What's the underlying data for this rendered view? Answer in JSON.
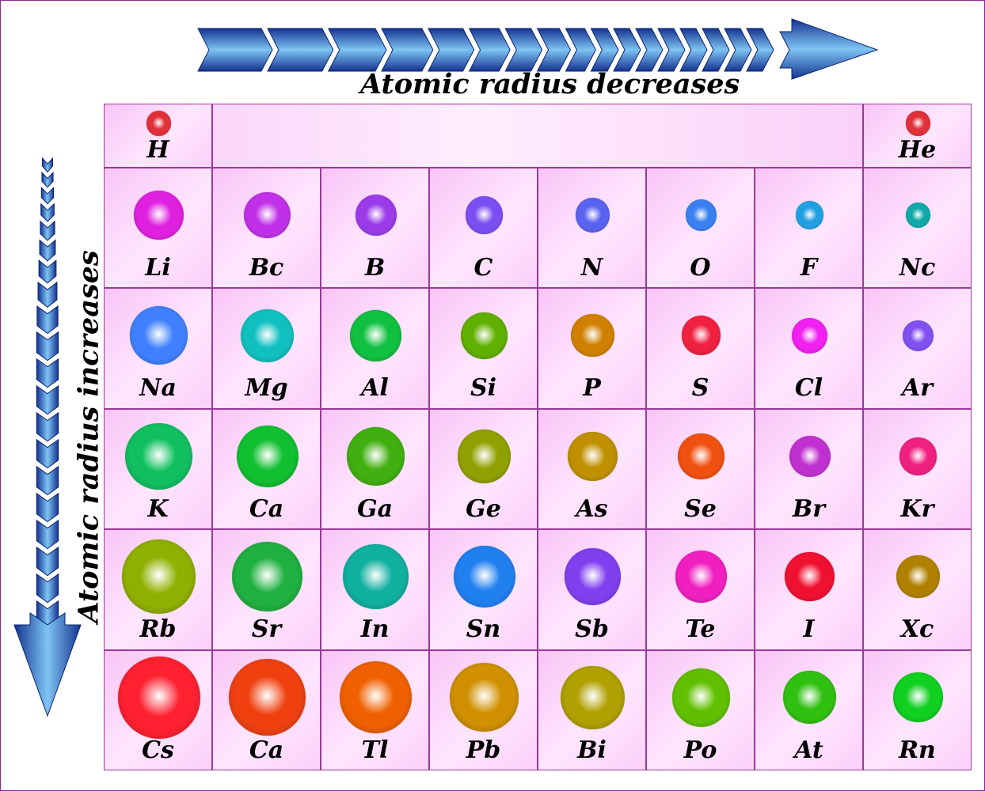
{
  "titles": {
    "horizontal": "Atomic radius decreases",
    "vertical": "Atomic radius increases"
  },
  "colors": {
    "arrow_dark": "#14328f",
    "arrow_light": "#7ec4f4",
    "cell_border": "#9a3a9a",
    "cell_fill": "#fbd0f8"
  },
  "rows": [
    [
      {
        "symbol": "H",
        "col": 0,
        "size": 0.3,
        "color": "#e0303a"
      },
      {
        "symbol": "He",
        "col": 7,
        "size": 0.3,
        "color": "#e0303a"
      }
    ],
    [
      {
        "symbol": "Li",
        "size": 0.6,
        "color": "#e020e0"
      },
      {
        "symbol": "Bc",
        "size": 0.56,
        "color": "#c030e8"
      },
      {
        "symbol": "B",
        "size": 0.5,
        "color": "#9a3ae8"
      },
      {
        "symbol": "C",
        "size": 0.46,
        "color": "#7a4ef0"
      },
      {
        "symbol": "N",
        "size": 0.42,
        "color": "#5a62f0"
      },
      {
        "symbol": "O",
        "size": 0.38,
        "color": "#3a80f0"
      },
      {
        "symbol": "F",
        "size": 0.34,
        "color": "#20a0e0"
      },
      {
        "symbol": "Nc",
        "size": 0.3,
        "color": "#10a8a8"
      }
    ],
    [
      {
        "symbol": "Na",
        "size": 0.71,
        "color": "#4080ff"
      },
      {
        "symbol": "Mg",
        "size": 0.65,
        "color": "#10c0c0"
      },
      {
        "symbol": "Al",
        "size": 0.62,
        "color": "#10c040"
      },
      {
        "symbol": "Si",
        "size": 0.56,
        "color": "#60b000"
      },
      {
        "symbol": "P",
        "size": 0.52,
        "color": "#d08000"
      },
      {
        "symbol": "S",
        "size": 0.48,
        "color": "#f02040"
      },
      {
        "symbol": "Cl",
        "size": 0.44,
        "color": "#f020f0"
      },
      {
        "symbol": "Ar",
        "size": 0.38,
        "color": "#8050f0"
      }
    ],
    [
      {
        "symbol": "K",
        "size": 0.81,
        "color": "#10c060"
      },
      {
        "symbol": "Ca",
        "size": 0.75,
        "color": "#10c030"
      },
      {
        "symbol": "Ga",
        "size": 0.71,
        "color": "#40b010"
      },
      {
        "symbol": "Ge",
        "size": 0.65,
        "color": "#90a000"
      },
      {
        "symbol": "As",
        "size": 0.6,
        "color": "#c09000"
      },
      {
        "symbol": "Se",
        "size": 0.56,
        "color": "#f05010"
      },
      {
        "symbol": "Br",
        "size": 0.5,
        "color": "#c030d0"
      },
      {
        "symbol": "Kr",
        "size": 0.46,
        "color": "#f02080"
      }
    ],
    [
      {
        "symbol": "Rb",
        "size": 0.9,
        "color": "#90b000"
      },
      {
        "symbol": "Sr",
        "size": 0.85,
        "color": "#20b040"
      },
      {
        "symbol": "In",
        "size": 0.79,
        "color": "#10b0a0"
      },
      {
        "symbol": "Sn",
        "size": 0.75,
        "color": "#2080f0"
      },
      {
        "symbol": "Sb",
        "size": 0.69,
        "color": "#8040f0"
      },
      {
        "symbol": "Te",
        "size": 0.63,
        "color": "#f020c0"
      },
      {
        "symbol": "I",
        "size": 0.6,
        "color": "#f01030"
      },
      {
        "symbol": "Xc",
        "size": 0.52,
        "color": "#b08000"
      }
    ],
    [
      {
        "symbol": "Cs",
        "size": 1.0,
        "color": "#ff2030"
      },
      {
        "symbol": "Ca",
        "size": 0.94,
        "color": "#f04010"
      },
      {
        "symbol": "Tl",
        "size": 0.88,
        "color": "#f06000"
      },
      {
        "symbol": "Pb",
        "size": 0.83,
        "color": "#d09000"
      },
      {
        "symbol": "Bi",
        "size": 0.77,
        "color": "#b0a000"
      },
      {
        "symbol": "Po",
        "size": 0.71,
        "color": "#60c000"
      },
      {
        "symbol": "At",
        "size": 0.65,
        "color": "#30c010"
      },
      {
        "symbol": "Rn",
        "size": 0.6,
        "color": "#10d020"
      }
    ]
  ]
}
